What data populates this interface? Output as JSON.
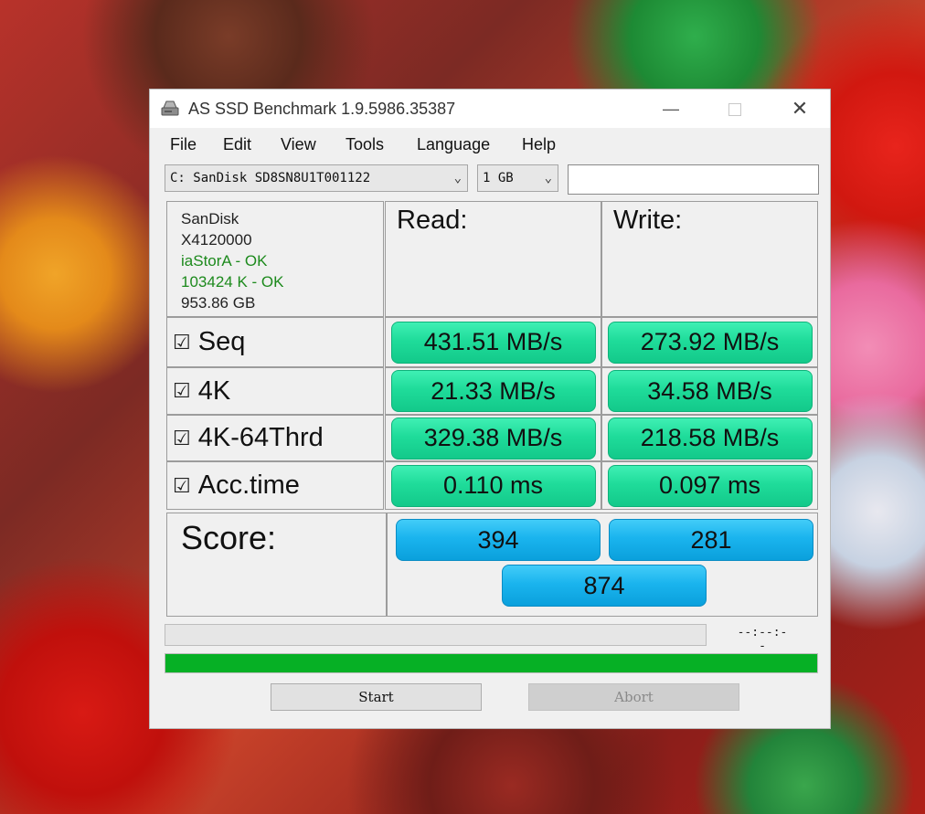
{
  "window": {
    "title": "AS SSD Benchmark 1.9.5986.35387",
    "minimize_glyph": "—",
    "close_glyph": "✕"
  },
  "menu": [
    "File",
    "Edit",
    "View",
    "Tools",
    "Language",
    "Help"
  ],
  "drive_select": {
    "value": "C: SanDisk SD8SN8U1T001122"
  },
  "size_select": {
    "value": "1 GB"
  },
  "drive_info": {
    "vendor": "SanDisk",
    "firmware": "X4120000",
    "driver_status": "iaStorA - OK",
    "alignment_status": "103424 K - OK",
    "capacity": "953.86 GB"
  },
  "headers": {
    "read": "Read:",
    "write": "Write:"
  },
  "tests": [
    {
      "label": "Seq",
      "checked": true,
      "read": "431.51 MB/s",
      "write": "273.92 MB/s"
    },
    {
      "label": "4K",
      "checked": true,
      "read": "21.33 MB/s",
      "write": "34.58 MB/s"
    },
    {
      "label": "4K-64Thrd",
      "checked": true,
      "read": "329.38 MB/s",
      "write": "218.58 MB/s"
    },
    {
      "label": "Acc.time",
      "checked": true,
      "read": "0.110 ms",
      "write": "0.097 ms"
    }
  ],
  "checkbox_glyph": "☑",
  "score": {
    "label": "Score:",
    "read": "394",
    "write": "281",
    "total": "874"
  },
  "progress": {
    "elapsed": "--:--:--",
    "fraction": 1.0
  },
  "buttons": {
    "start": "Start",
    "abort": "Abort"
  },
  "colors": {
    "result_green": "#1fdc9a",
    "score_blue": "#1ab4ee",
    "progress_green": "#06b025",
    "ok_text": "#1d8a1d"
  }
}
